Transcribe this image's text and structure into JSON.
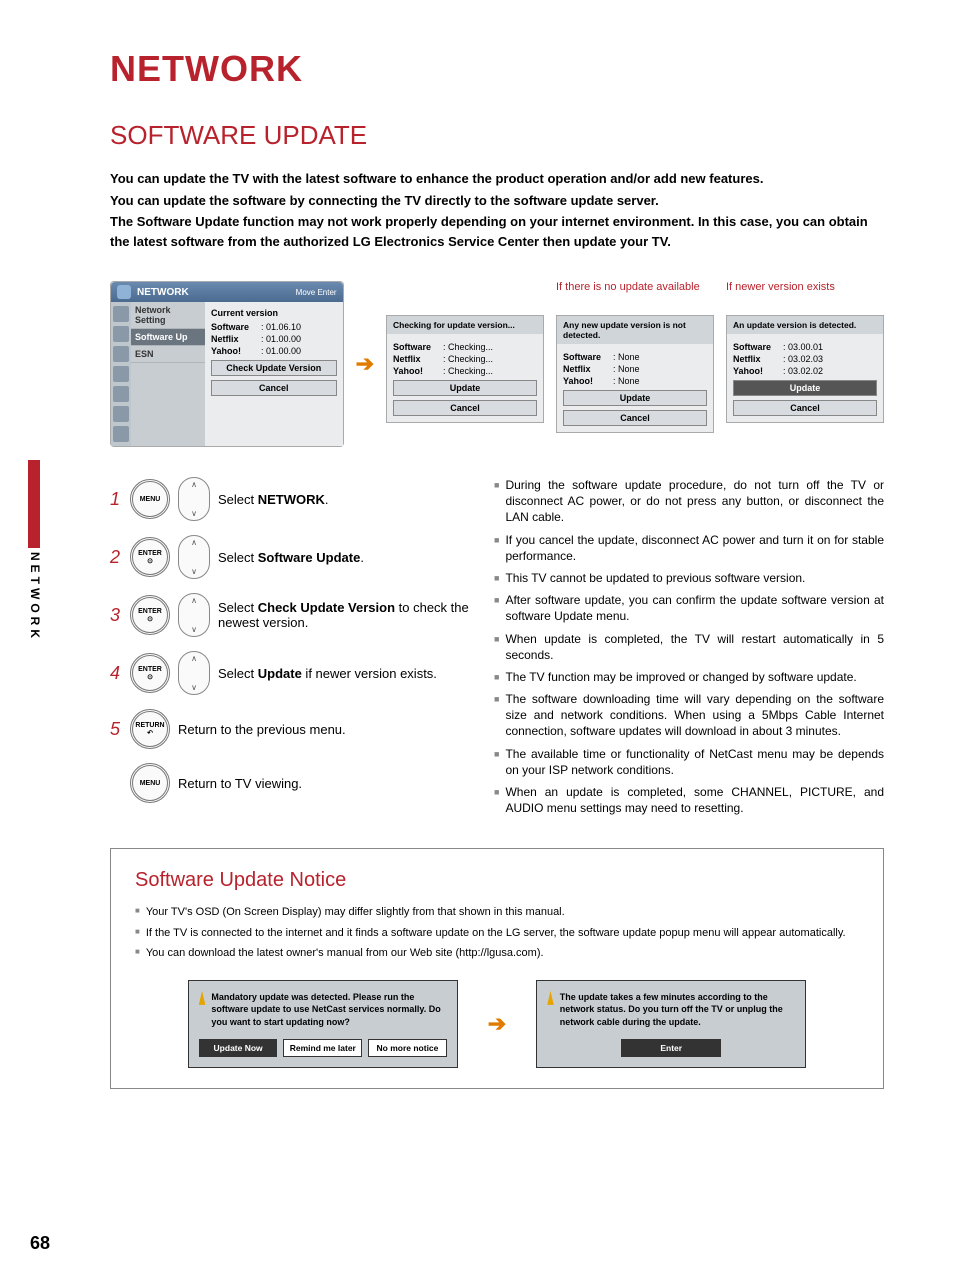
{
  "page_number": "68",
  "side_tab": "NETWORK",
  "title_main": "NETWORK",
  "title_sub": "SOFTWARE UPDATE",
  "intro": [
    "You can update the TV with the latest software to enhance the product operation and/or add new features.",
    "You can update the software by connecting the TV directly to the software update server.",
    "The Software Update function may not work properly depending on your internet environment. In this case, you can obtain the latest software from the authorized LG Electronics Service Center then update your TV."
  ],
  "menu": {
    "title": "NETWORK",
    "hint": "Move    Enter",
    "items": [
      "Network Setting",
      "Software Up",
      "ESN"
    ],
    "main_header": "Current version",
    "rows": [
      {
        "k": "Software",
        "v": ": 01.06.10"
      },
      {
        "k": "Netflix",
        "v": ": 01.00.00"
      },
      {
        "k": "Yahoo!",
        "v": ": 01.00.00"
      }
    ],
    "btn_primary": "Check Update Version",
    "btn_cancel": "Cancel"
  },
  "states": [
    {
      "caption": "",
      "header": "Checking for update version...",
      "rows": [
        {
          "k": "Software",
          "v": ": Checking..."
        },
        {
          "k": "Netflix",
          "v": ": Checking..."
        },
        {
          "k": "Yahoo!",
          "v": ": Checking..."
        }
      ],
      "btn1": "Update",
      "btn2": "Cancel"
    },
    {
      "caption": "If there is no update available",
      "header": "Any new update version is not detected.",
      "rows": [
        {
          "k": "Software",
          "v": ": None"
        },
        {
          "k": "Netflix",
          "v": ": None"
        },
        {
          "k": "Yahoo!",
          "v": ": None"
        }
      ],
      "btn1": "Update",
      "btn2": "Cancel"
    },
    {
      "caption": "If newer version exists",
      "header": "An update version is detected.",
      "rows": [
        {
          "k": "Software",
          "v": ": 03.00.01"
        },
        {
          "k": "Netflix",
          "v": ": 03.02.03"
        },
        {
          "k": "Yahoo!",
          "v": ": 03.02.02"
        }
      ],
      "btn1": "Update",
      "btn2": "Cancel",
      "dark": true
    }
  ],
  "steps": [
    {
      "n": "1",
      "btn": "MENU",
      "pad": true,
      "pre": "Select ",
      "bold": "NETWORK",
      "post": "."
    },
    {
      "n": "2",
      "btn": "ENTER",
      "pad": true,
      "pre": "Select ",
      "bold": "Software Update",
      "post": "."
    },
    {
      "n": "3",
      "btn": "ENTER",
      "pad": true,
      "pre": "Select ",
      "bold": "Check Update Version",
      "post": " to check the newest version."
    },
    {
      "n": "4",
      "btn": "ENTER",
      "pad": true,
      "pre": "Select  ",
      "bold": "Update",
      "post": " if newer version exists."
    },
    {
      "n": "5",
      "btn": "RETURN",
      "pad": false,
      "pre": "Return to the previous menu.",
      "bold": "",
      "post": ""
    },
    {
      "n": "",
      "btn": "MENU",
      "pad": false,
      "pre": "Return to TV viewing.",
      "bold": "",
      "post": ""
    }
  ],
  "notes": [
    "During the software update procedure, do not turn off the TV or disconnect AC power, or do not press any button, or disconnect the LAN cable.",
    "If you cancel the update, disconnect AC power and turn it on for stable performance.",
    "This TV cannot be updated to previous software version.",
    "After software update, you can confirm the update software version at software Update menu.",
    "When update is completed, the TV will restart automatically in 5 seconds.",
    "The TV function may be improved or changed by software update.",
    "The software downloading time will vary depending on the software size and network conditions. When using a 5Mbps Cable Internet connection, software updates will download in about 3 minutes.",
    "The available time or functionality of NetCast menu may be depends on your ISP network conditions.",
    "When an update is completed, some CHANNEL, PICTURE, and AUDIO menu settings may need to resetting."
  ],
  "notice": {
    "title": "Software Update Notice",
    "items": [
      "Your TV's OSD (On Screen Display) may differ slightly from that shown in this manual.",
      "If the TV is connected to the internet and it finds a software update on the LG server, the software update popup menu will appear automatically.",
      "You can download the latest owner's manual from our Web site (http://lgusa.com)."
    ],
    "popup1": {
      "text": "Mandatory update was detected. Please run the software update to use NetCast services normally. Do you want to start updating now?",
      "btns": [
        "Update Now",
        "Remind me later",
        "No more notice"
      ]
    },
    "popup2": {
      "text": "The update takes a few minutes according to the network status. Do you turn off the TV or unplug the network cable during the update.",
      "btns": [
        "Enter"
      ]
    }
  }
}
